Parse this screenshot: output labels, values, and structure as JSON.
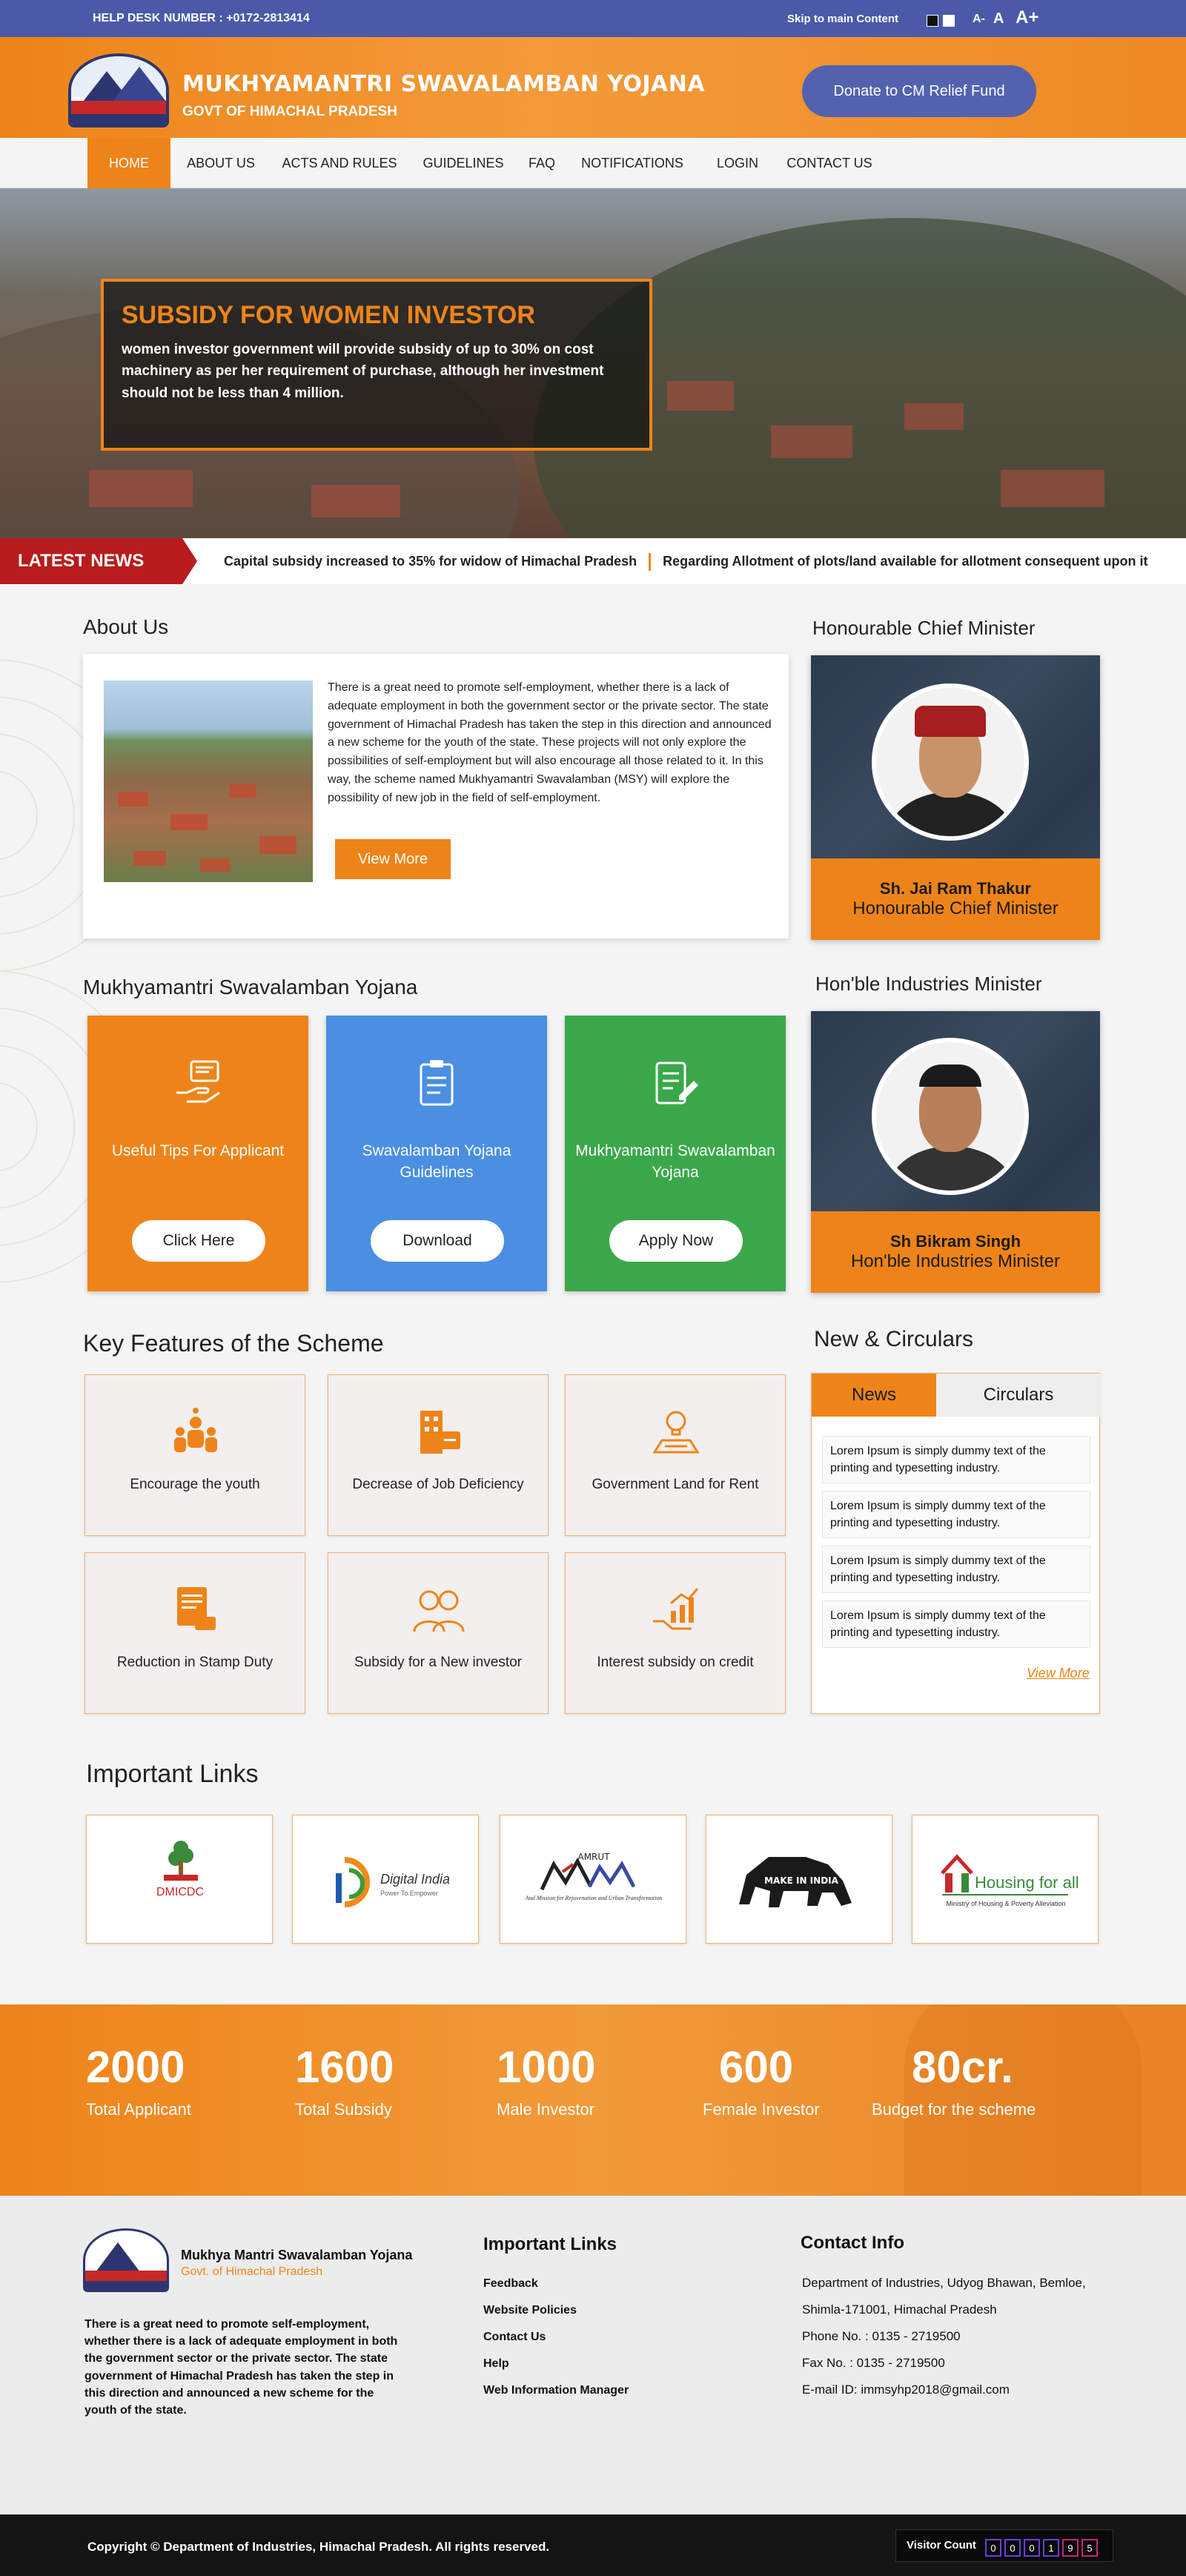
{
  "topbar": {
    "helpdesk": "HELP DESK NUMBER : +0172-2813414",
    "skip": "Skip to main Content",
    "font_minus": "A-",
    "font_normal": "A",
    "font_plus": "A+"
  },
  "header": {
    "title": "MUKHYAMANTRI SWAVALAMBAN YOJANA",
    "subtitle": "GOVT OF HIMACHAL PRADESH",
    "donate": "Donate to CM Relief Fund"
  },
  "nav": [
    "HOME",
    "ABOUT US",
    "ACTS AND RULES",
    "GUIDELINES",
    "FAQ",
    "NOTIFICATIONS",
    "LOGIN",
    "CONTACT US"
  ],
  "hero": {
    "title": "SUBSIDY FOR WOMEN INVESTOR",
    "text": "women investor government will provide subsidy of up to 30% on cost machinery as per her requirement of purchase, although her investment should not be less than 4 million."
  },
  "ticker": {
    "label": "LATEST NEWS",
    "items": [
      "Capital subsidy increased to 35% for widow of Himachal Pradesh",
      "Regarding Allotment of plots/land available for allotment consequent upon it"
    ]
  },
  "about": {
    "heading": "About Us",
    "text": "There is a great need to promote self-employment, whether there is a lack of adequate employment in both the government sector or the private sector. The state government of Himachal Pradesh has taken the step in this direction and announced a new scheme for the youth of the state. These projects will not only explore the possibilities of self-employment but will also encourage all those related to it. In this way, the scheme named Mukhyamantri Swavalamban (MSY) will explore the possibility of new job in the field of self-employment.",
    "button": "View More"
  },
  "chief_minister": {
    "heading": "Honourable Chief Minister",
    "name": "Sh. Jai Ram Thakur",
    "title": "Honourable Chief Minister"
  },
  "industries_minister": {
    "heading": "Hon'ble Industries Minister",
    "name": "Sh Bikram Singh",
    "title": "Hon'ble Industries Minister"
  },
  "scheme": {
    "heading": "Mukhyamantri Swavalamban Yojana",
    "cards": [
      {
        "title": "Useful Tips For Applicant",
        "button": "Click Here",
        "color": "#ee8419"
      },
      {
        "title": "Swavalamban Yojana Guidelines",
        "button": "Download",
        "color": "#4a8fe2"
      },
      {
        "title": "Mukhyamantri Swavalamban Yojana",
        "button": "Apply Now",
        "color": "#3aa84a"
      }
    ]
  },
  "features": {
    "heading": "Key Features of the Scheme",
    "items": [
      "Encourage the youth",
      "Decrease of Job Deficiency",
      "Government Land for Rent",
      "Reduction in Stamp Duty",
      "Subsidy for a New investor",
      "Interest subsidy on credit"
    ]
  },
  "news_circulars": {
    "heading": "New & Circulars",
    "tab_news": "News",
    "tab_circulars": "Circulars",
    "items": [
      "Lorem Ipsum is simply dummy text of the printing and typesetting industry.",
      "Lorem Ipsum is simply dummy text of the printing and typesetting industry.",
      "Lorem Ipsum is simply dummy text of the printing and typesetting industry.",
      "Lorem Ipsum is simply dummy text of the printing and typesetting industry."
    ],
    "view_more": "View More"
  },
  "important_links": {
    "heading": "Important Links",
    "logos": [
      {
        "name": "DMICDC"
      },
      {
        "name": "Digital India",
        "tagline": "Power To Empower"
      },
      {
        "name": "AMRUT",
        "tagline": "Atal Mission for Rejuvenation and Urban Transformation"
      },
      {
        "name": "MAKE IN INDIA"
      },
      {
        "name": "Housing for all",
        "tagline": "Ministry of Housing & Poverty Alleviation"
      }
    ]
  },
  "stats": [
    {
      "value": "2000",
      "label": "Total Applicant"
    },
    {
      "value": "1600",
      "label": "Total Subsidy"
    },
    {
      "value": "1000",
      "label": "Male Investor"
    },
    {
      "value": "600",
      "label": "Female Investor"
    },
    {
      "value": "80cr.",
      "label": "Budget for the scheme"
    }
  ],
  "footer": {
    "name": "Mukhya Mantri Swavalamban Yojana",
    "sub": "Govt. of Himachal Pradesh",
    "about": "There is a great need to promote self-employment, whether there is a lack of adequate employment in both the government sector or the private sector. The state government of Himachal Pradesh has taken the step in this direction and announced a new scheme for the youth of the state.",
    "links_heading": "Important  Links",
    "links": [
      "Feedback",
      "Website Policies",
      "Contact Us",
      "Help",
      "Web Information Manager"
    ],
    "contact_heading": "Contact Info",
    "contact": [
      "Department of Industries, Udyog Bhawan, Bemloe,",
      "Shimla-171001, Himachal Pradesh",
      "Phone No. : 0135 - 2719500",
      "Fax No. : 0135 - 2719500",
      "E-mail ID: immsyhp2018@gmail.com"
    ]
  },
  "bottom": {
    "copyright": "Copyright © Department of Industries, Himachal Pradesh. All rights reserved.",
    "visitor_label": "Visitor Count",
    "visitor_digits": [
      "0",
      "0",
      "0",
      "1",
      "9",
      "5"
    ]
  }
}
